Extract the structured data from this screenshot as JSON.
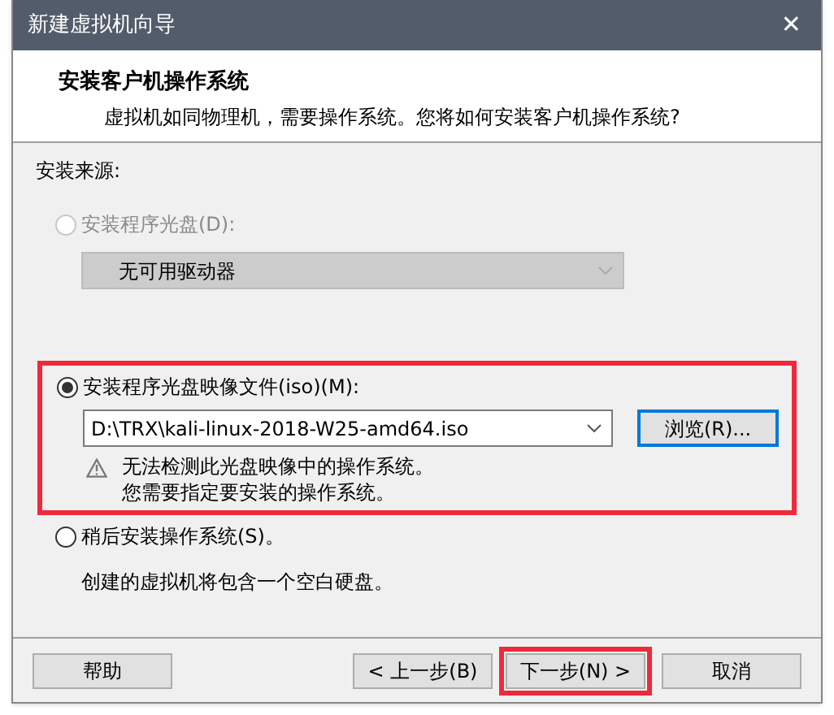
{
  "window": {
    "title": "新建虚拟机向导",
    "close": "✕"
  },
  "header": {
    "title": "安装客户机操作系统",
    "subtitle": "虚拟机如同物理机，需要操作系统。您将如何安装客户机操作系统?"
  },
  "source_label": "安装来源:",
  "options": [
    {
      "kind": "disc",
      "label": "安装程序光盘(D):",
      "selected": false,
      "disabled": true,
      "highlighted": false,
      "dropdown": "无可用驱动器"
    },
    {
      "kind": "iso",
      "label": "安装程序光盘映像文件(iso)(M):",
      "selected": true,
      "disabled": false,
      "highlighted": true,
      "path": "D:\\TRX\\kali-linux-2018-W25-amd64.iso",
      "browse": "浏览(R)...",
      "warning": [
        "无法检测此光盘映像中的操作系统。",
        "您需要指定要安装的操作系统。"
      ]
    },
    {
      "kind": "later",
      "label": "稍后安装操作系统(S)。",
      "selected": false,
      "disabled": false,
      "highlighted": false,
      "note": "创建的虚拟机将包含一个空白硬盘。"
    }
  ],
  "buttons": [
    {
      "label": "帮助",
      "highlighted": false
    },
    {
      "label": "< 上一步(B)",
      "highlighted": false
    },
    {
      "label": "下一步(N) >",
      "highlighted": true
    },
    {
      "label": "取消",
      "highlighted": false
    }
  ]
}
